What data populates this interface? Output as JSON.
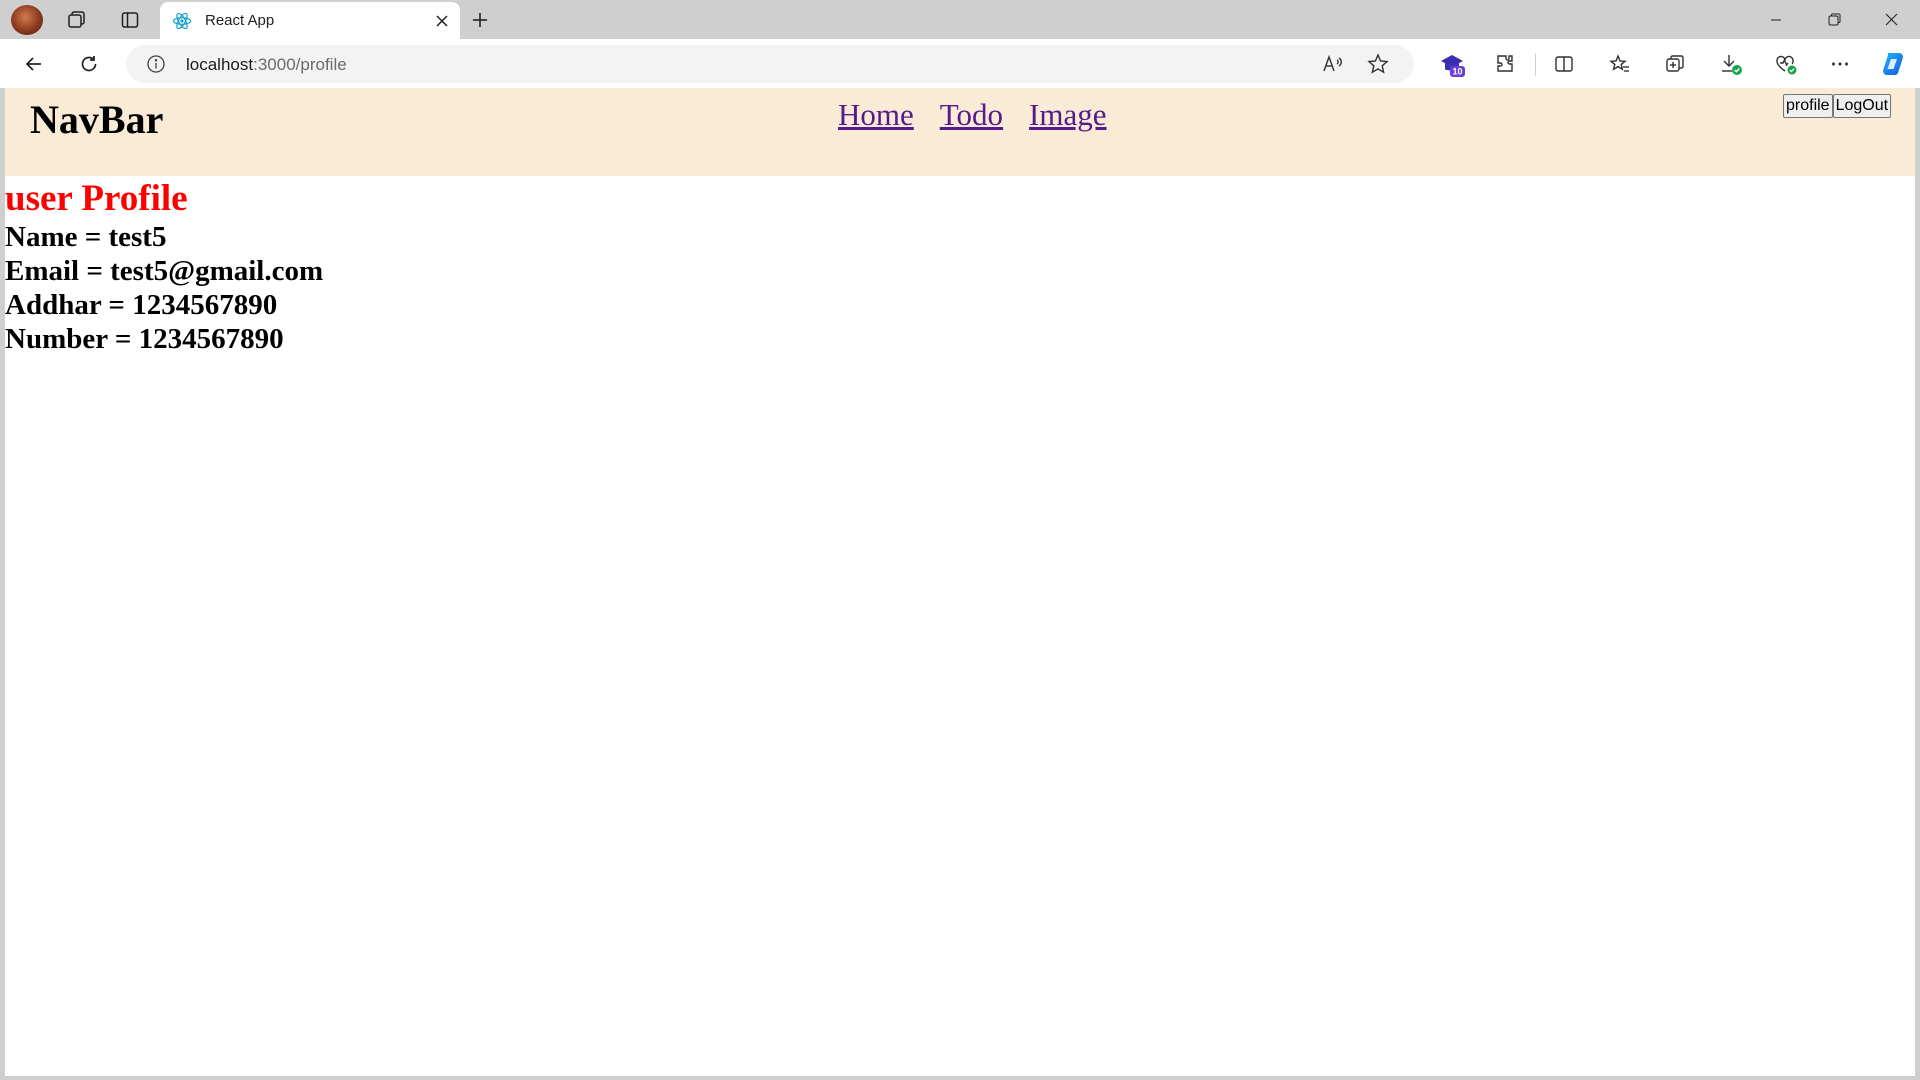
{
  "browser": {
    "tab": {
      "title": "React App",
      "favicon": "react-icon"
    },
    "address": {
      "host": "localhost",
      "path": ":3000/profile"
    },
    "extension_badge": "10",
    "icons": {
      "tabbar": [
        "workspaces-icon",
        "vertical-tabs-icon",
        "close-icon",
        "plus-icon",
        "minimize-icon",
        "restore-icon",
        "close-window-icon"
      ],
      "toolbar": [
        "back-icon",
        "refresh-icon",
        "site-info-icon",
        "read-aloud-icon",
        "favorite-star-icon",
        "extension-badge-icon",
        "extensions-icon",
        "split-screen-icon",
        "favorites-icon",
        "collections-icon",
        "downloads-icon",
        "browser-essentials-icon",
        "more-icon",
        "copilot-icon"
      ]
    }
  },
  "app": {
    "brand": "NavBar",
    "links": [
      "Home",
      "Todo",
      "Image"
    ],
    "buttons": {
      "profile": "profile",
      "logout": "LogOut"
    },
    "colors": {
      "nav_bg": "#faebd7",
      "heading": "#ff0000",
      "link": "#551a8b"
    }
  },
  "profile": {
    "title": "user Profile",
    "name": "Name = test5",
    "email": "Email = test5@gmail.com",
    "addhar": "Addhar = 1234567890",
    "number": "Number = 1234567890"
  }
}
